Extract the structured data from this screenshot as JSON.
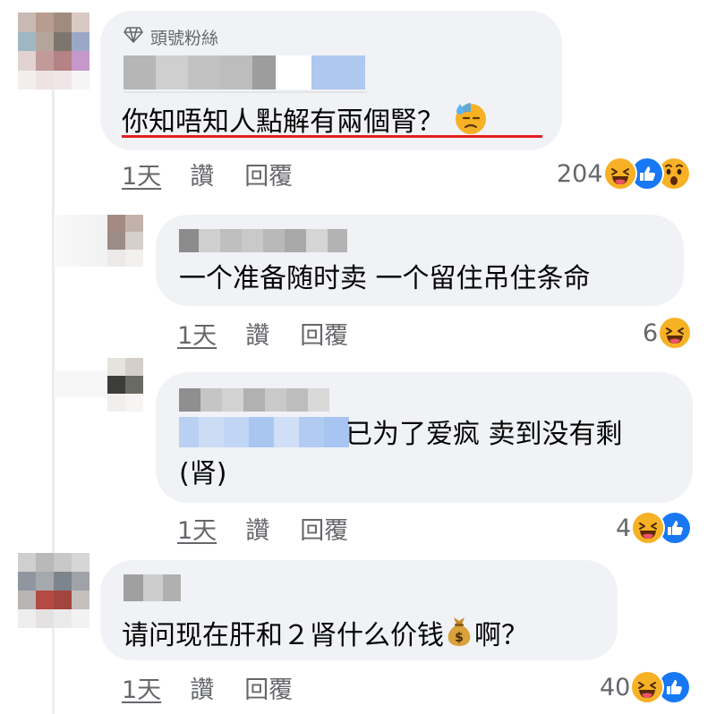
{
  "comments": [
    {
      "badge": "頭號粉絲",
      "text": "你知唔知人點解有兩個腎？",
      "emoji": "downcast-sweat-face-icon",
      "time": "1天",
      "like_label": "讚",
      "reply_label": "回覆",
      "reaction_count": "204",
      "reactions": [
        "haha",
        "like",
        "wow"
      ]
    },
    {
      "text": "一个准备随时卖 一个留住吊住条命",
      "time": "1天",
      "like_label": "讚",
      "reply_label": "回覆",
      "reaction_count": "6",
      "reactions": [
        "haha"
      ]
    },
    {
      "text_line1": "已为了爱疯 卖到没有剩",
      "text_line2": "(肾)",
      "time": "1天",
      "like_label": "讚",
      "reply_label": "回覆",
      "reaction_count": "4",
      "reactions": [
        "haha",
        "like"
      ]
    },
    {
      "text_before": "请问现在肝和２肾什么价钱",
      "emoji": "money-bag-icon",
      "text_after": "啊？",
      "time": "1天",
      "like_label": "讚",
      "reply_label": "回覆",
      "reaction_count": "40",
      "reactions": [
        "haha",
        "like"
      ]
    }
  ],
  "colors": {
    "bubble": "#f0f2f5",
    "meta_text": "#65676b",
    "like_blue": "#1877f2",
    "emoji_yellow": "#f7b125",
    "underline_red": "#e41e1e"
  }
}
